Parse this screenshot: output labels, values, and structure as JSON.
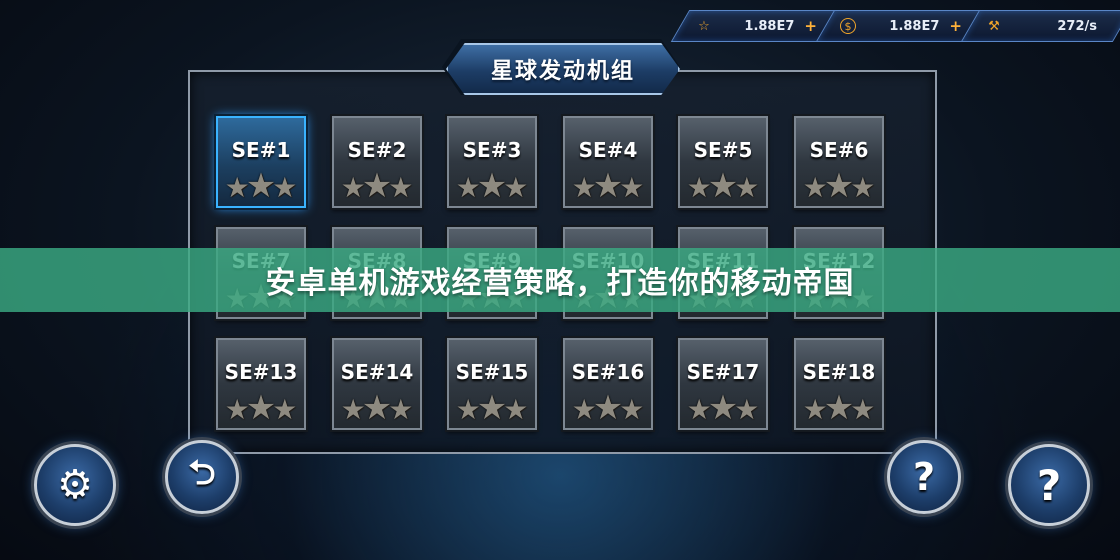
{
  "resources": {
    "stars": {
      "icon": "star-icon",
      "value": "1.88E7",
      "plus": "+"
    },
    "coins": {
      "icon": "coin-icon",
      "value": "1.88E7",
      "plus": "+"
    },
    "rate": {
      "icon": "wrench-icon",
      "value": "272/s"
    }
  },
  "panel": {
    "title": "星球发动机组",
    "levels": [
      {
        "label": "SE#1",
        "active": true
      },
      {
        "label": "SE#2"
      },
      {
        "label": "SE#3"
      },
      {
        "label": "SE#4"
      },
      {
        "label": "SE#5"
      },
      {
        "label": "SE#6"
      },
      {
        "label": "SE#7"
      },
      {
        "label": "SE#8"
      },
      {
        "label": "SE#9"
      },
      {
        "label": "SE#10"
      },
      {
        "label": "SE#11"
      },
      {
        "label": "SE#12"
      },
      {
        "label": "SE#13"
      },
      {
        "label": "SE#14"
      },
      {
        "label": "SE#15"
      },
      {
        "label": "SE#16"
      },
      {
        "label": "SE#17"
      },
      {
        "label": "SE#18"
      }
    ],
    "stars_per_level": 3
  },
  "banner": {
    "text": "安卓单机游戏经营策略，打造你的移动帝国"
  },
  "buttons": {
    "settings": {
      "icon": "gear-icon",
      "glyph": "⚙"
    },
    "back": {
      "icon": "return-arrow-icon",
      "glyph": "⮌"
    },
    "help_left": {
      "icon": "question-icon",
      "glyph": "?"
    },
    "help_right": {
      "icon": "question-icon",
      "glyph": "?"
    }
  },
  "colors": {
    "accent": "#3ab3ff",
    "banner": "#3aaa82",
    "plus": "#ffb23a"
  }
}
